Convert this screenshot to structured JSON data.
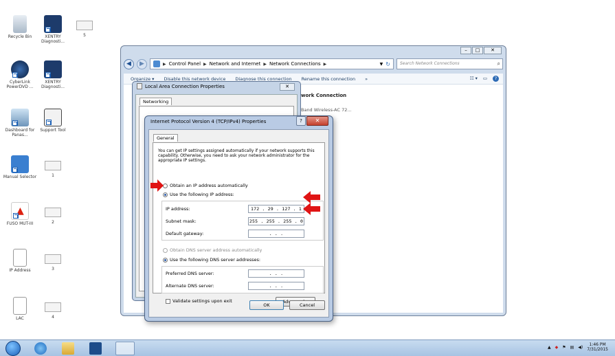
{
  "desktop": {
    "icons": [
      {
        "label": "Recycle Bin"
      },
      {
        "label": "XENTRY Diagnosti..."
      },
      {
        "label": "5"
      },
      {
        "label": "CyberLink PowerDVD ..."
      },
      {
        "label": "XENTRY Diagnosti..."
      },
      {
        "label": "Dashboard for Panas..."
      },
      {
        "label": "Support Tool"
      },
      {
        "label": "Manual Selector"
      },
      {
        "label": "1"
      },
      {
        "label": "FUSO MUT-III"
      },
      {
        "label": "2"
      },
      {
        "label": "IP Address"
      },
      {
        "label": "3"
      },
      {
        "label": "LAC"
      },
      {
        "label": "4"
      }
    ]
  },
  "explorer": {
    "breadcrumbs": [
      "Control Panel",
      "Network and Internet",
      "Network Connections"
    ],
    "search_placeholder": "Search Network Connections",
    "toolbar": {
      "organize": "Organize ▾",
      "disable": "Disable this network device",
      "diagnose": "Diagnose this connection",
      "rename": "Rename this connection",
      "more": "»"
    },
    "connection_name": "work Connection",
    "connection_adapter": "Band Wireless-AC 72..."
  },
  "lan_dialog": {
    "title": "Local Area Connection Properties",
    "tab": "Networking"
  },
  "ipv4_dialog": {
    "title": "Internet Protocol Version 4 (TCP/IPv4) Properties",
    "tab": "General",
    "intro": "You can get IP settings assigned automatically if your network supports this capability. Otherwise, you need to ask your network administrator for the appropriate IP settings.",
    "obtain_ip_auto": "Obtain an IP address automatically",
    "use_following_ip": "Use the following IP address:",
    "ip_label": "IP address:",
    "ip_value": "172 . 29 . 127 . 1",
    "subnet_label": "Subnet mask:",
    "subnet_value": "255 . 255 . 255 . 0",
    "gateway_label": "Default gateway:",
    "gateway_value": ". . .",
    "obtain_dns_auto": "Obtain DNS server address automatically",
    "use_following_dns": "Use the following DNS server addresses:",
    "preferred_dns_label": "Preferred DNS server:",
    "preferred_dns_value": ". . .",
    "alternate_dns_label": "Alternate DNS server:",
    "alternate_dns_value": ". . .",
    "validate": "Validate settings upon exit",
    "advanced": "Advanced...",
    "ok": "OK",
    "cancel": "Cancel"
  },
  "taskbar": {
    "time": "1:46 PM",
    "date": "7/31/2015"
  },
  "colors": {
    "arrow": "#e01414",
    "dialog_frame": "#b9cbe4"
  }
}
